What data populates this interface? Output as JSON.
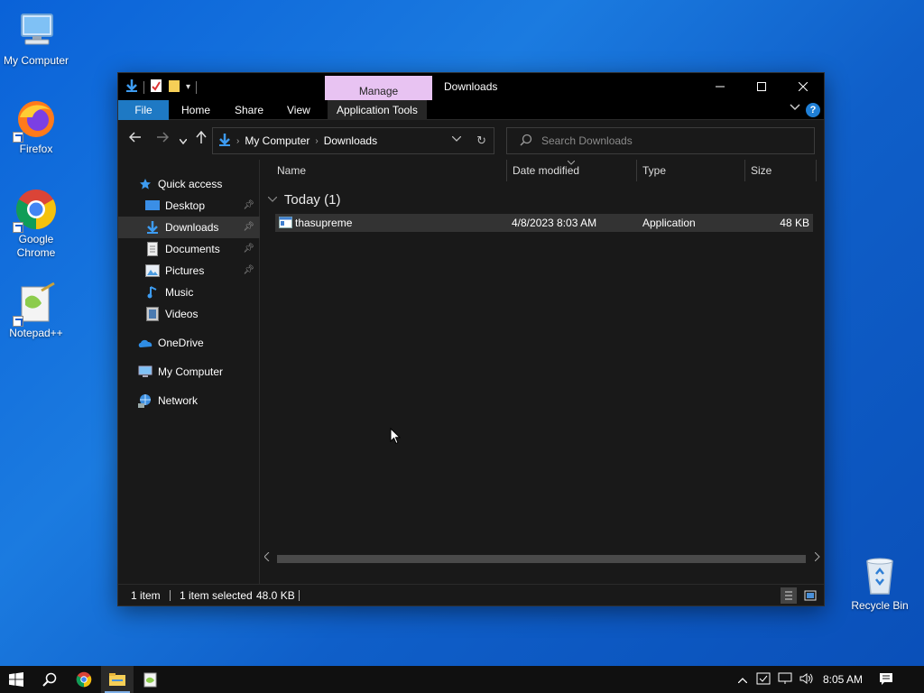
{
  "desktop": {
    "icons": [
      {
        "label": "My Computer"
      },
      {
        "label": "Firefox"
      },
      {
        "label": "Google Chrome"
      },
      {
        "label": "Notepad++"
      },
      {
        "label": "Recycle Bin"
      }
    ]
  },
  "window": {
    "title": "Downloads",
    "manage_tab": "Manage",
    "ribbon_tabs": [
      "File",
      "Home",
      "Share",
      "View",
      "Application Tools"
    ],
    "help_label": "?",
    "breadcrumb": [
      "My Computer",
      "Downloads"
    ],
    "search_placeholder": "Search Downloads",
    "nav": {
      "quick_access": "Quick access",
      "items": [
        "Desktop",
        "Downloads",
        "Documents",
        "Pictures",
        "Music",
        "Videos"
      ],
      "onedrive": "OneDrive",
      "my_computer": "My Computer",
      "network": "Network"
    },
    "columns": [
      "Name",
      "Date modified",
      "Type",
      "Size"
    ],
    "group_label": "Today (1)",
    "files": [
      {
        "name": "thasupreme",
        "date": "4/8/2023 8:03 AM",
        "type": "Application",
        "size": "48 KB"
      }
    ],
    "status": {
      "count": "1 item",
      "selected": "1 item selected",
      "size": "48.0 KB"
    }
  },
  "taskbar": {
    "clock": "8:05 AM"
  },
  "colors": {
    "accent": "#1e79c4",
    "manage": "#e8c3f2",
    "window_bg": "#191919",
    "desktop": "#0a62d8"
  }
}
